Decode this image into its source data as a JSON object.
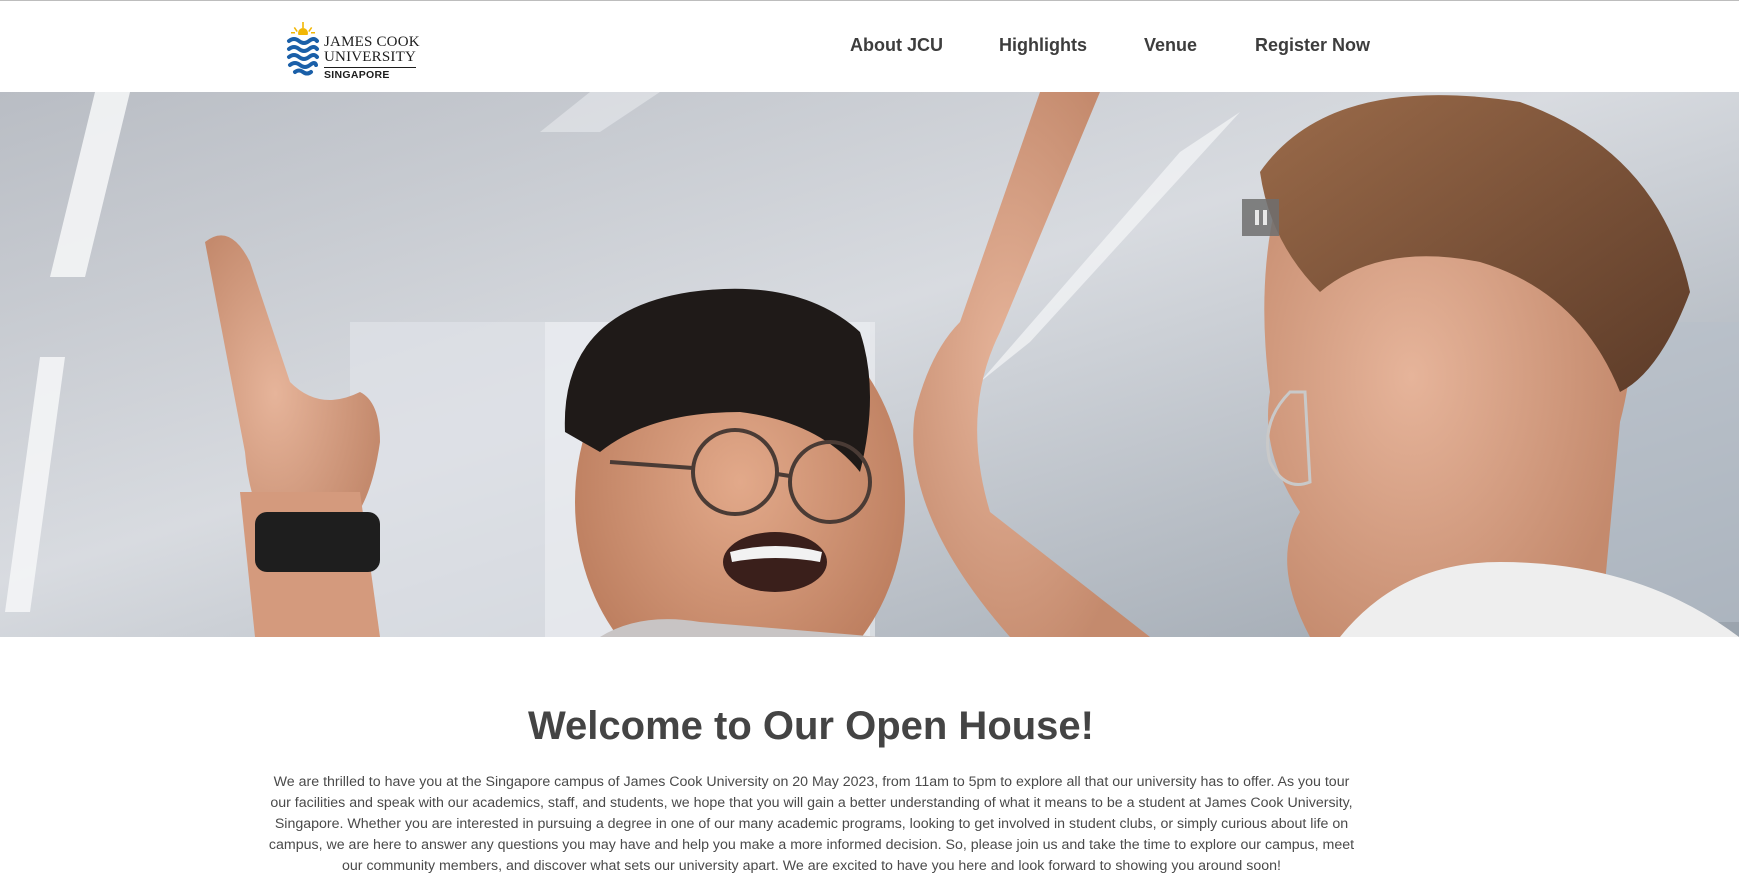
{
  "header": {
    "logo": {
      "line1": "JAMES COOK",
      "line2": "UNIVERSITY",
      "line3": "SINGAPORE",
      "icon": "jcu-wave-shield-icon"
    },
    "nav": [
      "About JCU",
      "Highlights",
      "Venue",
      "Register Now"
    ]
  },
  "hero": {
    "media": "video",
    "control": {
      "icon": "pause-icon",
      "state": "playing"
    }
  },
  "main": {
    "title": "Welcome to Our Open House!",
    "intro": "We are thrilled to have you at the Singapore campus of James Cook University on 20 May 2023, from 11am to 5pm to explore all that our university has to offer. As you tour our facilities and speak with our academics, staff, and students, we hope that you will gain a better understanding of what it means to be a student at James Cook University, Singapore. Whether you are interested in pursuing a degree in one of our many academic programs, looking to get involved in student clubs, or simply curious about life on campus, we are here to answer any questions you may have and help you make a more informed decision. So, please join us and take the time to explore our campus, meet our community members, and discover what sets our university apart. We are excited to have you here and look forward to showing you around soon!"
  },
  "colors": {
    "brand_blue": "#1a5fa8",
    "brand_gold": "#f2b705",
    "text": "#444444"
  }
}
